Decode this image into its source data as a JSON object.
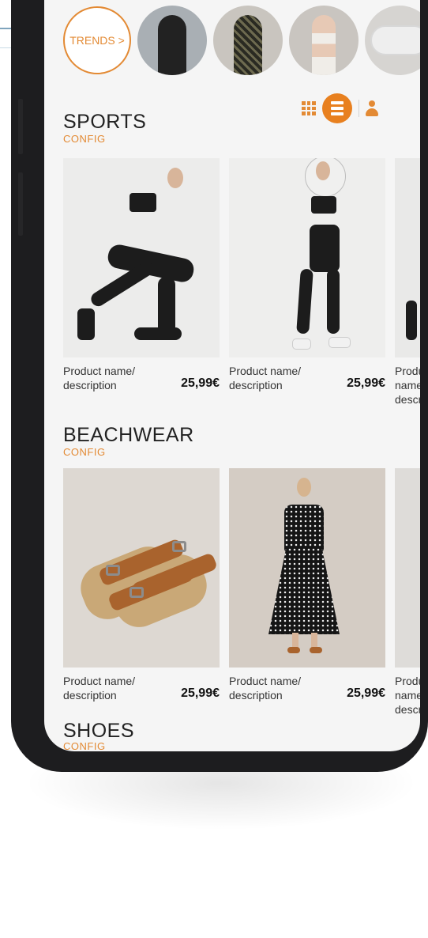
{
  "stories": {
    "trends_label": "TRENDS >",
    "items": [
      "story-sportswear",
      "story-shirt",
      "story-bikini",
      "story-slippers"
    ]
  },
  "view_toggles": {
    "icons": [
      "grid-view-icon",
      "list-view-icon",
      "profile-icon"
    ],
    "active": "list-view-icon"
  },
  "sections": [
    {
      "title": "SPORTS",
      "subtitle": "CONFIG",
      "products": [
        {
          "name": "Product name/\ndescription",
          "price": "25,99€"
        },
        {
          "name": "Product name/\ndescription",
          "price": "25,99€"
        },
        {
          "name": "Product name/\ndescription",
          "price": ""
        }
      ]
    },
    {
      "title": "BEACHWEAR",
      "subtitle": "CONFIG",
      "products": [
        {
          "name": "Product name/\ndescription",
          "price": "25,99€"
        },
        {
          "name": "Product name/\ndescription",
          "price": "25,99€"
        },
        {
          "name": "Product name/\ndescription",
          "price": ""
        }
      ]
    },
    {
      "title": "SHOES",
      "subtitle": "CONFIG"
    }
  ],
  "colors": {
    "accent": "#e38a34",
    "screen_bg": "#f5f5f5",
    "phone_frame": "#1d1d1f"
  }
}
